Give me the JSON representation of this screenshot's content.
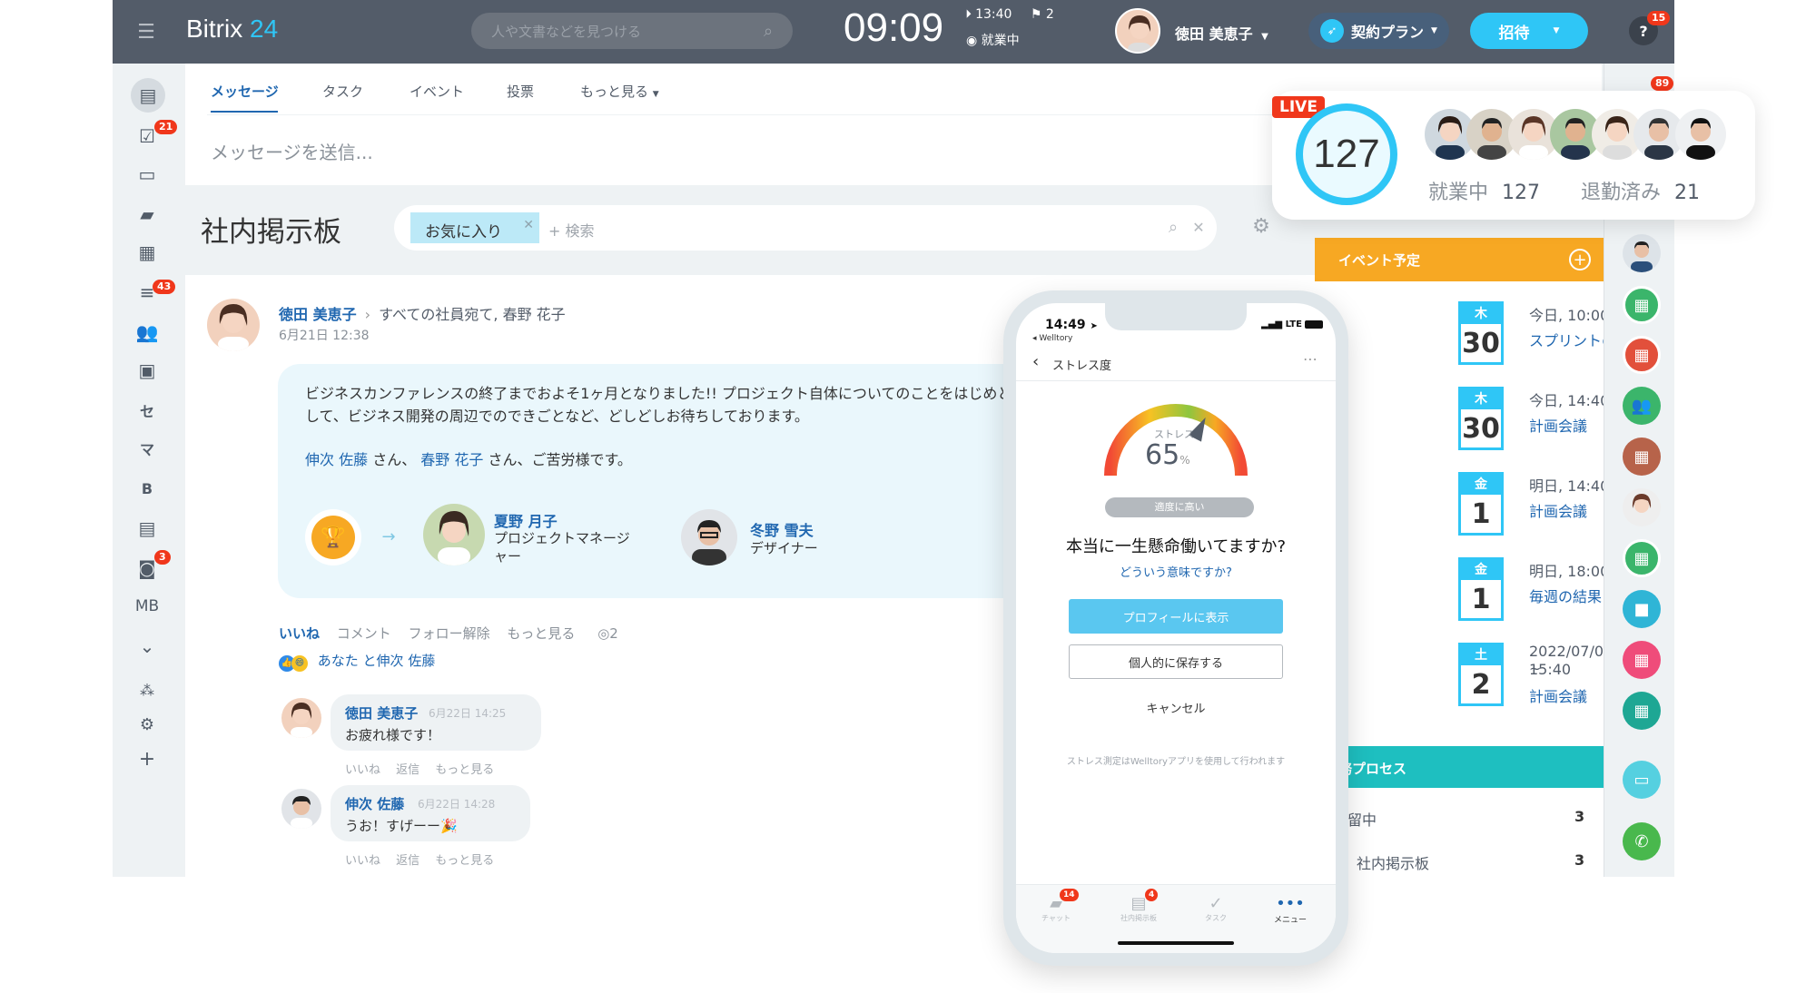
{
  "topbar": {
    "logo_text": "Bitrix",
    "logo_num": "24",
    "search_placeholder": "人や文書などを見つける",
    "clock": "09:09",
    "last_time": "13:40",
    "flag_count": "2",
    "work_status": "就業中",
    "user_name": "徳田 美恵子",
    "plan_label": "契約プラン",
    "invite_label": "招待",
    "help_badge": "15"
  },
  "left_nav": {
    "badges": [
      "21",
      "43",
      "3"
    ],
    "letters": [
      "セ",
      "マ",
      "B",
      "MB"
    ]
  },
  "tabs": [
    "メッセージ",
    "タスク",
    "イベント",
    "投票",
    "もっと見る"
  ],
  "composer_placeholder": "メッセージを送信...",
  "board": {
    "title": "社内掲示板",
    "filter_chip": "お気に入り",
    "search_placeholder": "検索"
  },
  "post": {
    "author": "徳田 美恵子",
    "recipients": "すべての社員宛て, 春野 花子",
    "date": "6月21日 12:38",
    "body": "ビジネスカンファレンスの終了までおよそ1ヶ月となりました!! プロジェクト自体についてのことをはじめとして、ビジネス開発の周辺でのできごとなど、どしどしお待ちしております。",
    "mention1": "伸次 佐藤",
    "mention2": "春野 花子",
    "mention_sep": "さん、",
    "mention_tail": "さん、ご苦労様です。",
    "person1_name": "夏野 月子",
    "person1_role": "プロジェクトマネージャー",
    "person2_name": "冬野 雪夫",
    "person2_role": "デザイナー",
    "actions": [
      "いいね",
      "コメント",
      "フォロー解除",
      "もっと見る"
    ],
    "views": "2",
    "likes": "あなた と伸次 佐藤"
  },
  "comments": [
    {
      "name": "徳田 美恵子",
      "date": "6月22日 14:25",
      "text": "お疲れ様です！",
      "actions": "いいね　 返信　 もっと見る"
    },
    {
      "name": "伸次 佐藤",
      "date": "6月22日 14:28",
      "text": "うお！すげーー🎉",
      "actions": "いいね　 返信　 もっと見る"
    }
  ],
  "live": {
    "tag": "LIVE",
    "count": "127",
    "working_label": "就業中",
    "working_count": "127",
    "left_label": "退勤済み",
    "left_count": "21",
    "top_badge": "89"
  },
  "events": {
    "header": "イベント予定",
    "items": [
      {
        "dow": "木",
        "day": "30",
        "time": "今日, 10:00 ~ 11:00",
        "title": "スプリントの計画"
      },
      {
        "dow": "木",
        "day": "30",
        "time": "今日, 14:40 ~ 15:40",
        "title": "計画会議"
      },
      {
        "dow": "金",
        "day": "1",
        "time": "明日, 14:40 ~ 15:40",
        "title": "計画会議"
      },
      {
        "dow": "金",
        "day": "1",
        "time": "明日, 18:00 ~ 19:00",
        "title": "毎週の結果"
      },
      {
        "dow": "土",
        "day": "2",
        "time": "2022/07/02, 14:40 ~",
        "time2": "15:40",
        "title": "計画会議"
      }
    ]
  },
  "process": {
    "header": "務プロセス",
    "rows": [
      {
        "label": "留中",
        "count": "3"
      },
      {
        "label": "社内掲示板",
        "count": "3"
      }
    ]
  },
  "phone": {
    "time": "14:49",
    "app_back": "Welltory",
    "network": "LTE",
    "title": "ストレス度",
    "gauge_label": "ストレス",
    "gauge_value": "65",
    "gauge_unit": "%",
    "level_pill": "適度に高い",
    "stress_level": 0.65,
    "question": "本当に一生懸命働いてますか?",
    "question_link": "どういう意味ですか?",
    "btn_primary": "プロフィールに表示",
    "btn_secondary": "個人的に保存する",
    "btn_cancel": "キャンセル",
    "footnote": "ストレス測定はWelltoryアプリを使用して行われます",
    "tabbar": [
      {
        "label": "チャット",
        "badge": "14"
      },
      {
        "label": "社内掲示板",
        "badge": "4"
      },
      {
        "label": "タスク",
        "badge": ""
      },
      {
        "label": "メニュー",
        "badge": ""
      }
    ]
  },
  "colors": {
    "topbar": "#535c69",
    "accent_blue": "#2fc6f6",
    "live_red": "#f0371b",
    "events_orange": "#f7a823",
    "process_teal": "#1ebfc0",
    "invite_btn": "#2fc6f6"
  }
}
